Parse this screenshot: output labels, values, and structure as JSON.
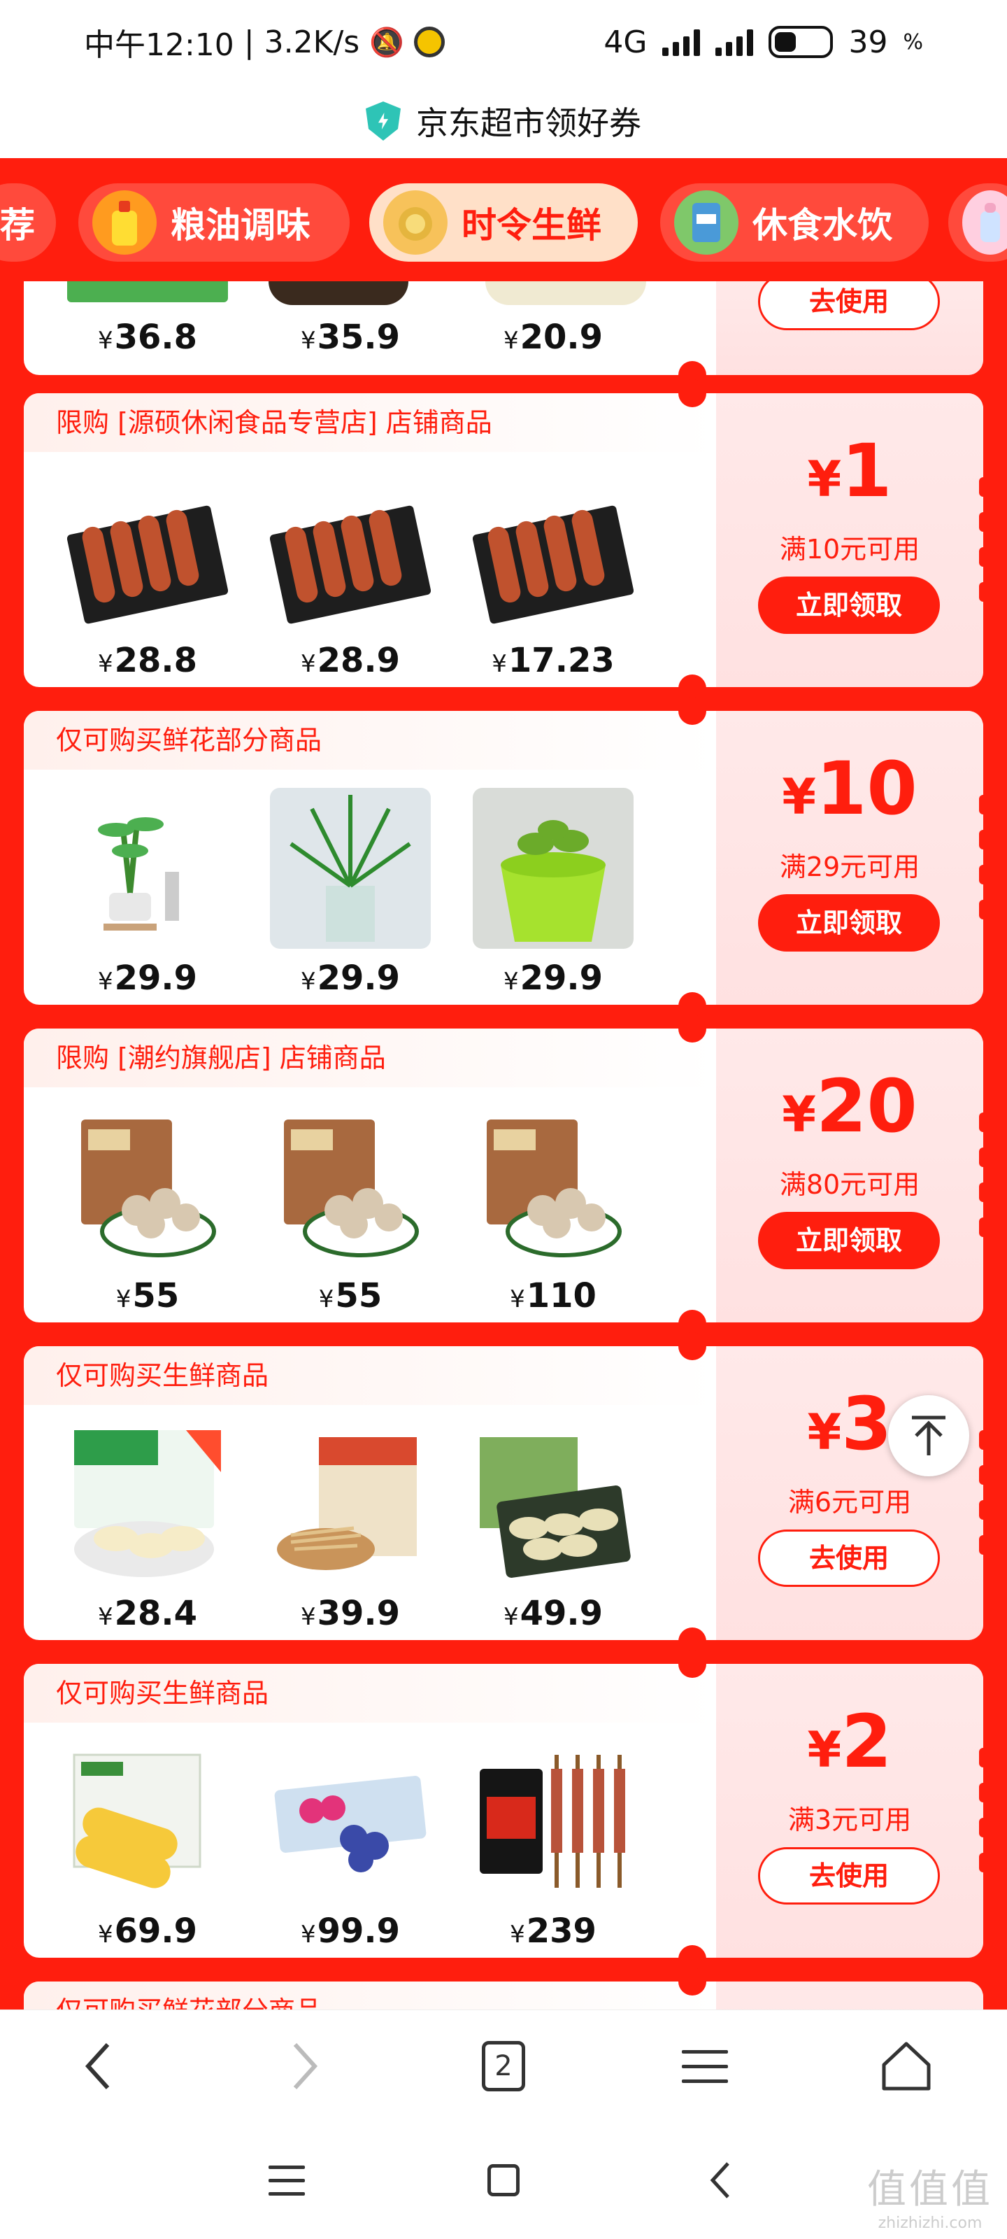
{
  "status_bar": {
    "time": "中午12:10",
    "net_speed": "3.2K/s",
    "network": "4G",
    "battery": "39"
  },
  "title_bar": {
    "title": "京东超市领好券"
  },
  "tabs": [
    {
      "label": "荐",
      "active": false
    },
    {
      "label": "粮油调味",
      "active": false
    },
    {
      "label": "时令生鲜",
      "active": true
    },
    {
      "label": "休食水饮",
      "active": false
    }
  ],
  "cards": [
    {
      "header": "",
      "products": [
        {
          "price": "36.8"
        },
        {
          "price": "35.9"
        },
        {
          "price": "20.9"
        }
      ],
      "amount": "",
      "condition": "",
      "button": "去使用",
      "button_type": "use"
    },
    {
      "header": "限购 [源硕休闲食品专营店] 店铺商品",
      "products": [
        {
          "price": "28.8"
        },
        {
          "price": "28.9"
        },
        {
          "price": "17.23"
        }
      ],
      "amount": "1",
      "condition": "满10元可用",
      "button": "立即领取",
      "button_type": "claim"
    },
    {
      "header": "仅可购买鲜花部分商品",
      "products": [
        {
          "price": "29.9"
        },
        {
          "price": "29.9"
        },
        {
          "price": "29.9"
        }
      ],
      "amount": "10",
      "condition": "满29元可用",
      "button": "立即领取",
      "button_type": "claim"
    },
    {
      "header": "限购 [潮约旗舰店] 店铺商品",
      "products": [
        {
          "price": "55"
        },
        {
          "price": "55"
        },
        {
          "price": "110"
        }
      ],
      "amount": "20",
      "condition": "满80元可用",
      "button": "立即领取",
      "button_type": "claim"
    },
    {
      "header": "仅可购买生鲜商品",
      "products": [
        {
          "price": "28.4"
        },
        {
          "price": "39.9"
        },
        {
          "price": "49.9"
        }
      ],
      "amount": "3",
      "condition": "满6元可用",
      "button": "去使用",
      "button_type": "use"
    },
    {
      "header": "仅可购买生鲜商品",
      "products": [
        {
          "price": "69.9"
        },
        {
          "price": "99.9"
        },
        {
          "price": "239"
        }
      ],
      "amount": "2",
      "condition": "满3元可用",
      "button": "去使用",
      "button_type": "use"
    },
    {
      "header": "仅可购买鲜花部分商品",
      "products": [],
      "amount": "",
      "condition": "",
      "button": "",
      "button_type": ""
    }
  ],
  "currency_symbol": "¥",
  "toolbar": {
    "tab_count": "2"
  },
  "watermark": {
    "top": "值值值",
    "bottom": "zhizhizhi.com"
  },
  "colors": {
    "brand_red": "#ff1e0e",
    "coupon_bg": "#ffe6e6",
    "tab_active_bg": "#ffe0c8"
  }
}
